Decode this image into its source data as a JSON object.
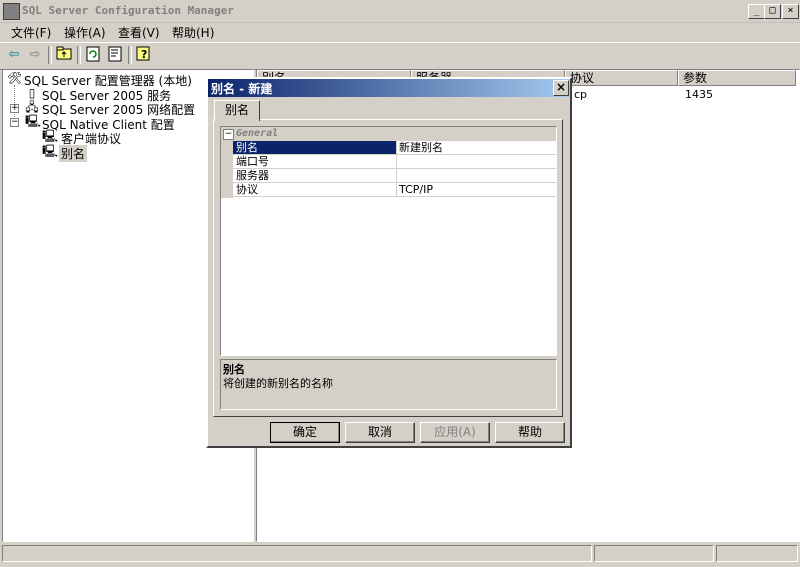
{
  "window": {
    "title": "SQL Server Configuration Manager",
    "min": "_",
    "max": "□",
    "close": "×"
  },
  "menu": [
    "文件(F)",
    "操作(A)",
    "查看(V)",
    "帮助(H)"
  ],
  "tree": {
    "root": "SQL Server 配置管理器 (本地)",
    "services": "SQL Server 2005 服务",
    "network": "SQL Server 2005 网络配置",
    "native": "SQL Native Client 配置",
    "client_protocols": "客户端协议",
    "aliases": "别名"
  },
  "list": {
    "columns": [
      "别名",
      "服务器",
      "协议",
      "参数"
    ],
    "rows": [
      {
        "protocol": "cp",
        "param": "1435"
      }
    ]
  },
  "dialog": {
    "title": "别名 - 新建",
    "tab": "别名",
    "category": "General",
    "props": [
      {
        "name": "别名",
        "value": "新建别名"
      },
      {
        "name": "端口号",
        "value": ""
      },
      {
        "name": "服务器",
        "value": ""
      },
      {
        "name": "协议",
        "value": "TCP/IP"
      }
    ],
    "desc_title": "别名",
    "desc_text": "将创建的新别名的名称",
    "buttons": {
      "ok": "确定",
      "cancel": "取消",
      "apply": "应用(A)",
      "help": "帮助"
    }
  },
  "colors": {
    "selection": "#0a246a",
    "dialog_title_start": "#0a246a",
    "dialog_title_end": "#a6caf0"
  }
}
